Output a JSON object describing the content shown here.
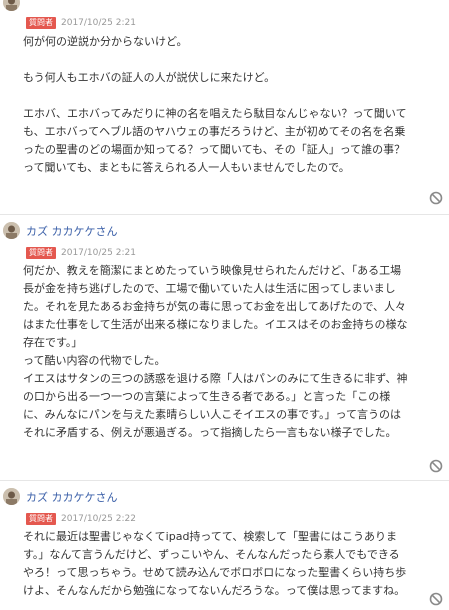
{
  "posts": [
    {
      "username": "",
      "badge": "質問者",
      "time": "2017/10/25 2:21",
      "body": "何が何の逆説か分からないけど。\n\nもう何人もエホバの証人の人が説伏しに来たけど。\n\nエホバ、エホバってみだりに神の名を唱えたら駄目なんじゃない？って聞いて\nも、エホバってヘブル語のヤハウェの事だろうけど、主が初めてその名を名乗\nったの聖書のどの場面か知ってる？って聞いても、その「証人」って誰の事？\nって聞いても、まともに答えられる人一人もいませんでしたので。"
    },
    {
      "username": "カズ カカケケ",
      "honorific": "さん",
      "badge": "質問者",
      "time": "2017/10/25 2:21",
      "body": "何だか、教えを簡潔にまとめたっていう映像見せられたんだけど、「ある工場\n長が金を持ち逃げしたので、工場で働いていた人は生活に困ってしまいまし\nた。それを見たあるお金持ちが気の毒に思ってお金を出してあげたので、人々\nはまた仕事をして生活が出来る様になりました。イエスはそのお金持ちの様な\n存在です。」\nって酷い内容の代物でした。\nイエスはサタンの三つの誘惑を退ける際「人はパンのみにて生きるに非ず、神\nの口から出る一つ一つの言葉によって生きる者である。」と言った「この様\nに、みんなにパンを与えた素晴らしい人こそイエスの事です。」って言うのは\nそれに矛盾する、例えが悪過ぎる。って指摘したら一言もない様子でした。"
    },
    {
      "username": "カズ カカケケ",
      "honorific": "さん",
      "badge": "質問者",
      "time": "2017/10/25 2:22",
      "body": "それに最近は聖書じゃなくてipad持ってて、検索して「聖書にはこうありま\nす。」なんて言うんだけど、ずっこいやん、そんなんだったら素人でもできる\nやろ！って思っちゃう。せめて読み込んでボロボロになった聖書くらい持ち歩\nけよ、そんなんだから勉強になってないんだろうな。って僕は思ってますね。"
    }
  ],
  "icons": {
    "ban": "no-entry-icon",
    "avatar": "user-avatar"
  },
  "colors": {
    "username": "#3a5fa8",
    "badge": "#e4584f",
    "text": "#333333",
    "time": "#999999"
  }
}
